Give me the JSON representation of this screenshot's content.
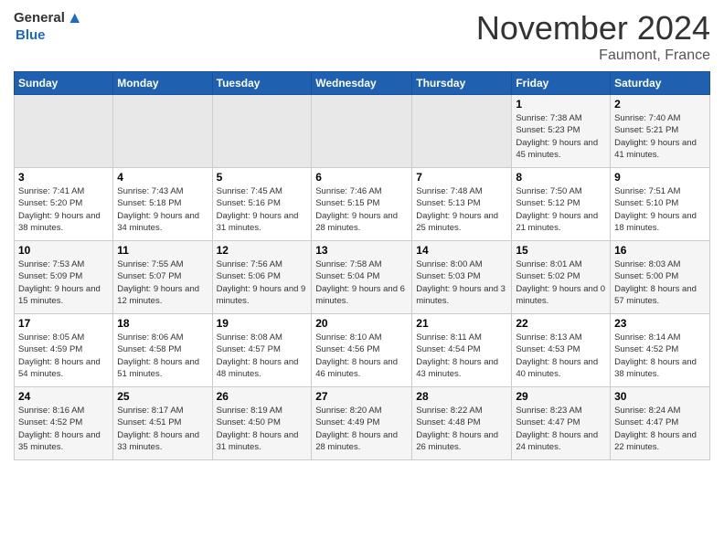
{
  "header": {
    "logo_general": "General",
    "logo_blue": "Blue",
    "month_title": "November 2024",
    "location": "Faumont, France"
  },
  "days_of_week": [
    "Sunday",
    "Monday",
    "Tuesday",
    "Wednesday",
    "Thursday",
    "Friday",
    "Saturday"
  ],
  "weeks": [
    [
      {
        "day": "",
        "sunrise": "",
        "sunset": "",
        "daylight": "",
        "empty": true
      },
      {
        "day": "",
        "sunrise": "",
        "sunset": "",
        "daylight": "",
        "empty": true
      },
      {
        "day": "",
        "sunrise": "",
        "sunset": "",
        "daylight": "",
        "empty": true
      },
      {
        "day": "",
        "sunrise": "",
        "sunset": "",
        "daylight": "",
        "empty": true
      },
      {
        "day": "",
        "sunrise": "",
        "sunset": "",
        "daylight": "",
        "empty": true
      },
      {
        "day": "1",
        "sunrise": "Sunrise: 7:38 AM",
        "sunset": "Sunset: 5:23 PM",
        "daylight": "Daylight: 9 hours and 45 minutes.",
        "empty": false
      },
      {
        "day": "2",
        "sunrise": "Sunrise: 7:40 AM",
        "sunset": "Sunset: 5:21 PM",
        "daylight": "Daylight: 9 hours and 41 minutes.",
        "empty": false
      }
    ],
    [
      {
        "day": "3",
        "sunrise": "Sunrise: 7:41 AM",
        "sunset": "Sunset: 5:20 PM",
        "daylight": "Daylight: 9 hours and 38 minutes.",
        "empty": false
      },
      {
        "day": "4",
        "sunrise": "Sunrise: 7:43 AM",
        "sunset": "Sunset: 5:18 PM",
        "daylight": "Daylight: 9 hours and 34 minutes.",
        "empty": false
      },
      {
        "day": "5",
        "sunrise": "Sunrise: 7:45 AM",
        "sunset": "Sunset: 5:16 PM",
        "daylight": "Daylight: 9 hours and 31 minutes.",
        "empty": false
      },
      {
        "day": "6",
        "sunrise": "Sunrise: 7:46 AM",
        "sunset": "Sunset: 5:15 PM",
        "daylight": "Daylight: 9 hours and 28 minutes.",
        "empty": false
      },
      {
        "day": "7",
        "sunrise": "Sunrise: 7:48 AM",
        "sunset": "Sunset: 5:13 PM",
        "daylight": "Daylight: 9 hours and 25 minutes.",
        "empty": false
      },
      {
        "day": "8",
        "sunrise": "Sunrise: 7:50 AM",
        "sunset": "Sunset: 5:12 PM",
        "daylight": "Daylight: 9 hours and 21 minutes.",
        "empty": false
      },
      {
        "day": "9",
        "sunrise": "Sunrise: 7:51 AM",
        "sunset": "Sunset: 5:10 PM",
        "daylight": "Daylight: 9 hours and 18 minutes.",
        "empty": false
      }
    ],
    [
      {
        "day": "10",
        "sunrise": "Sunrise: 7:53 AM",
        "sunset": "Sunset: 5:09 PM",
        "daylight": "Daylight: 9 hours and 15 minutes.",
        "empty": false
      },
      {
        "day": "11",
        "sunrise": "Sunrise: 7:55 AM",
        "sunset": "Sunset: 5:07 PM",
        "daylight": "Daylight: 9 hours and 12 minutes.",
        "empty": false
      },
      {
        "day": "12",
        "sunrise": "Sunrise: 7:56 AM",
        "sunset": "Sunset: 5:06 PM",
        "daylight": "Daylight: 9 hours and 9 minutes.",
        "empty": false
      },
      {
        "day": "13",
        "sunrise": "Sunrise: 7:58 AM",
        "sunset": "Sunset: 5:04 PM",
        "daylight": "Daylight: 9 hours and 6 minutes.",
        "empty": false
      },
      {
        "day": "14",
        "sunrise": "Sunrise: 8:00 AM",
        "sunset": "Sunset: 5:03 PM",
        "daylight": "Daylight: 9 hours and 3 minutes.",
        "empty": false
      },
      {
        "day": "15",
        "sunrise": "Sunrise: 8:01 AM",
        "sunset": "Sunset: 5:02 PM",
        "daylight": "Daylight: 9 hours and 0 minutes.",
        "empty": false
      },
      {
        "day": "16",
        "sunrise": "Sunrise: 8:03 AM",
        "sunset": "Sunset: 5:00 PM",
        "daylight": "Daylight: 8 hours and 57 minutes.",
        "empty": false
      }
    ],
    [
      {
        "day": "17",
        "sunrise": "Sunrise: 8:05 AM",
        "sunset": "Sunset: 4:59 PM",
        "daylight": "Daylight: 8 hours and 54 minutes.",
        "empty": false
      },
      {
        "day": "18",
        "sunrise": "Sunrise: 8:06 AM",
        "sunset": "Sunset: 4:58 PM",
        "daylight": "Daylight: 8 hours and 51 minutes.",
        "empty": false
      },
      {
        "day": "19",
        "sunrise": "Sunrise: 8:08 AM",
        "sunset": "Sunset: 4:57 PM",
        "daylight": "Daylight: 8 hours and 48 minutes.",
        "empty": false
      },
      {
        "day": "20",
        "sunrise": "Sunrise: 8:10 AM",
        "sunset": "Sunset: 4:56 PM",
        "daylight": "Daylight: 8 hours and 46 minutes.",
        "empty": false
      },
      {
        "day": "21",
        "sunrise": "Sunrise: 8:11 AM",
        "sunset": "Sunset: 4:54 PM",
        "daylight": "Daylight: 8 hours and 43 minutes.",
        "empty": false
      },
      {
        "day": "22",
        "sunrise": "Sunrise: 8:13 AM",
        "sunset": "Sunset: 4:53 PM",
        "daylight": "Daylight: 8 hours and 40 minutes.",
        "empty": false
      },
      {
        "day": "23",
        "sunrise": "Sunrise: 8:14 AM",
        "sunset": "Sunset: 4:52 PM",
        "daylight": "Daylight: 8 hours and 38 minutes.",
        "empty": false
      }
    ],
    [
      {
        "day": "24",
        "sunrise": "Sunrise: 8:16 AM",
        "sunset": "Sunset: 4:52 PM",
        "daylight": "Daylight: 8 hours and 35 minutes.",
        "empty": false
      },
      {
        "day": "25",
        "sunrise": "Sunrise: 8:17 AM",
        "sunset": "Sunset: 4:51 PM",
        "daylight": "Daylight: 8 hours and 33 minutes.",
        "empty": false
      },
      {
        "day": "26",
        "sunrise": "Sunrise: 8:19 AM",
        "sunset": "Sunset: 4:50 PM",
        "daylight": "Daylight: 8 hours and 31 minutes.",
        "empty": false
      },
      {
        "day": "27",
        "sunrise": "Sunrise: 8:20 AM",
        "sunset": "Sunset: 4:49 PM",
        "daylight": "Daylight: 8 hours and 28 minutes.",
        "empty": false
      },
      {
        "day": "28",
        "sunrise": "Sunrise: 8:22 AM",
        "sunset": "Sunset: 4:48 PM",
        "daylight": "Daylight: 8 hours and 26 minutes.",
        "empty": false
      },
      {
        "day": "29",
        "sunrise": "Sunrise: 8:23 AM",
        "sunset": "Sunset: 4:47 PM",
        "daylight": "Daylight: 8 hours and 24 minutes.",
        "empty": false
      },
      {
        "day": "30",
        "sunrise": "Sunrise: 8:24 AM",
        "sunset": "Sunset: 4:47 PM",
        "daylight": "Daylight: 8 hours and 22 minutes.",
        "empty": false
      }
    ]
  ]
}
